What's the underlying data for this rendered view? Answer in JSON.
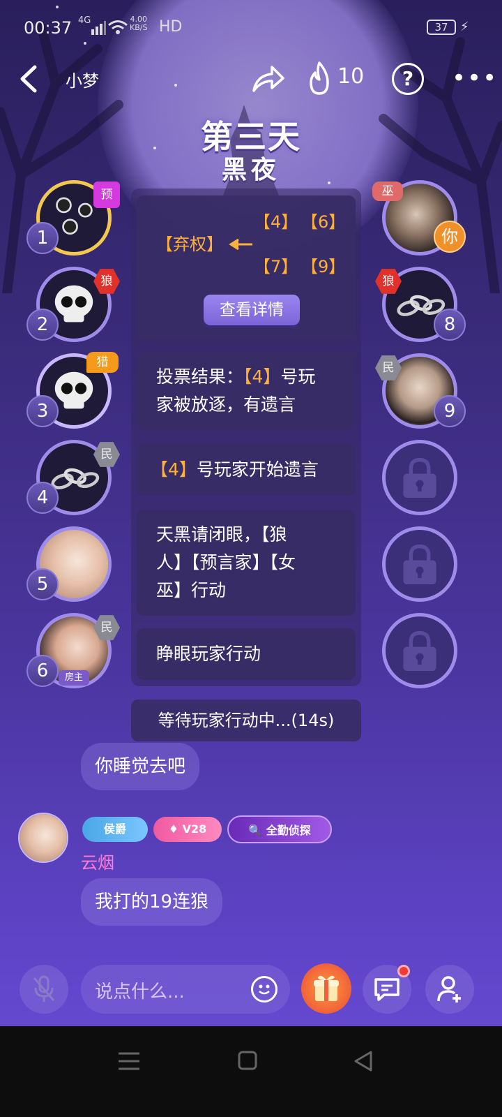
{
  "status_bar": {
    "time": "00:37",
    "network": "4G",
    "speed_value": "4.00",
    "speed_unit": "KB/S",
    "hd": "HD",
    "battery": "37"
  },
  "header": {
    "room_name": "小梦",
    "fire_count": "10",
    "help": "?",
    "more": "•••"
  },
  "phase": {
    "day": "第三天",
    "time_of_day": "黑夜"
  },
  "seats": {
    "left": [
      {
        "number": "1",
        "role": "预",
        "role_kind": "seer",
        "avatar": "bullet-holes-icon"
      },
      {
        "number": "2",
        "role": "狼",
        "role_kind": "wolf",
        "avatar": "skull-icon"
      },
      {
        "number": "3",
        "role": "猎",
        "role_kind": "hunter",
        "avatar": "skull-icon"
      },
      {
        "number": "4",
        "role": "民",
        "role_kind": "villager",
        "avatar": "chain-icon"
      },
      {
        "number": "5",
        "role": "",
        "role_kind": "",
        "avatar": "photo"
      },
      {
        "number": "6",
        "role": "民",
        "role_kind": "villager",
        "avatar": "photo",
        "host_label": "房主"
      }
    ],
    "right": [
      {
        "number": "",
        "role": "巫",
        "role_kind": "witch",
        "avatar": "photo",
        "you_label": "你"
      },
      {
        "number": "8",
        "role": "狼",
        "role_kind": "wolf",
        "avatar": "chain-icon"
      },
      {
        "number": "9",
        "role": "民",
        "role_kind": "villager",
        "avatar": "photo"
      },
      {
        "locked": true
      },
      {
        "locked": true
      },
      {
        "locked": true
      }
    ]
  },
  "vote_card": {
    "abstain": "【弃权】",
    "targets_row1": [
      "【4】",
      "【6】"
    ],
    "targets_row2": [
      "【7】",
      "【9】"
    ],
    "detail_button": "查看详情"
  },
  "log": {
    "vote_result_prefix": "投票结果：",
    "vote_result_target": "【4】",
    "vote_result_suffix_line1": "号玩",
    "vote_result_line2": "家被放逐，有遗言",
    "last_words_target": "【4】",
    "last_words_text": "号玩家开始遗言",
    "night_line1": "天黑请闭眼，【狼",
    "night_line2": "人】【预言家】【女",
    "night_line3": "巫】行动",
    "open_eyes": "睁眼玩家行动",
    "waiting": "等待玩家行动中...(14s)"
  },
  "chat": {
    "prev_message": "你睡觉去吧",
    "badges": {
      "rank": "侯爵",
      "vip": "V28",
      "detective": "全勤侦探"
    },
    "user_name": "云烟",
    "message": "我打的19连狼"
  },
  "bottom": {
    "input_placeholder": "说点什么..."
  },
  "colors": {
    "accent_orange": "#ffb03a",
    "wolf_red": "#e0312a",
    "name_pink": "#ff7ad6",
    "seer_magenta": "#d63adf"
  }
}
